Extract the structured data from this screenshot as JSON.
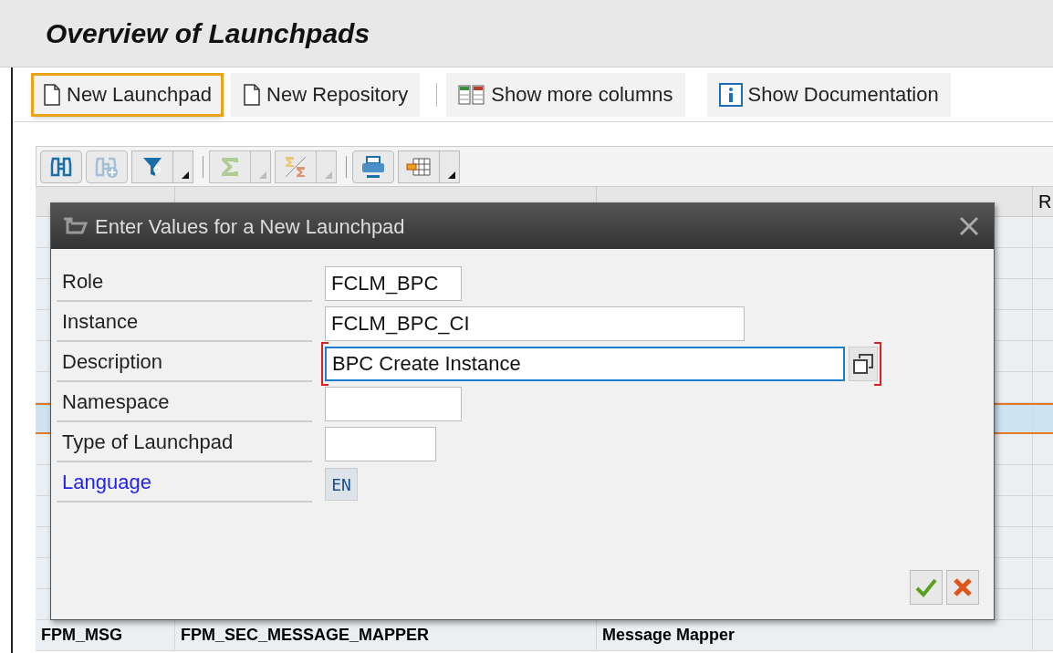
{
  "title": "Overview of Launchpads",
  "toolbar": [
    {
      "label": "New Launchpad",
      "kind": "document",
      "highlighted": true
    },
    {
      "label": "New Repository",
      "kind": "document",
      "highlighted": false
    },
    {
      "label": "Show more columns",
      "kind": "columns",
      "highlighted": false
    },
    {
      "label": "Show Documentation",
      "kind": "info",
      "highlighted": false
    }
  ],
  "grid_toolbar": [
    {
      "kind": "find",
      "disabled": false,
      "dropdown": false
    },
    {
      "kind": "find_next",
      "disabled": true,
      "dropdown": false
    },
    {
      "kind": "filter",
      "disabled": false,
      "dropdown": true
    },
    {
      "kind": "sum",
      "disabled": true,
      "dropdown": true
    },
    {
      "kind": "subtotal",
      "disabled": true,
      "dropdown": true
    },
    {
      "kind": "print",
      "disabled": false,
      "dropdown": false
    },
    {
      "kind": "layout",
      "disabled": false,
      "dropdown": true
    }
  ],
  "table": {
    "columns": [
      "",
      "",
      "",
      "R"
    ],
    "rows": [
      {
        "selected": false,
        "cells": []
      },
      {
        "selected": false,
        "cells": []
      },
      {
        "selected": false,
        "cells": []
      },
      {
        "selected": false,
        "cells": []
      },
      {
        "selected": false,
        "cells": []
      },
      {
        "selected": false,
        "cells": []
      },
      {
        "selected": true,
        "cells": []
      },
      {
        "selected": false,
        "cells": []
      },
      {
        "selected": false,
        "cells": []
      },
      {
        "selected": false,
        "cells": []
      },
      {
        "selected": false,
        "cells": []
      },
      {
        "selected": false,
        "cells": []
      },
      {
        "selected": false,
        "cells": []
      },
      {
        "selected": false,
        "cells": [
          "FPM_MSG",
          "FPM_SEC_MESSAGE_MAPPER",
          "Message Mapper"
        ]
      }
    ]
  },
  "dialog": {
    "title": "Enter Values for a New Launchpad",
    "fields": [
      {
        "label": "Role",
        "value": "FCLM_BPC",
        "kind": "input"
      },
      {
        "label": "Instance",
        "value": "FCLM_BPC_CI",
        "kind": "input"
      },
      {
        "label": "Description",
        "value": "BPC Create Instance",
        "kind": "input",
        "focused": true
      },
      {
        "label": "Namespace",
        "kind": "input"
      },
      {
        "label": "Type of Launchpad",
        "kind": "input"
      },
      {
        "label": "Language",
        "value": "EN",
        "kind": "display"
      }
    ],
    "buttons": [
      {
        "kind": "ok"
      },
      {
        "kind": "cancel"
      }
    ]
  }
}
